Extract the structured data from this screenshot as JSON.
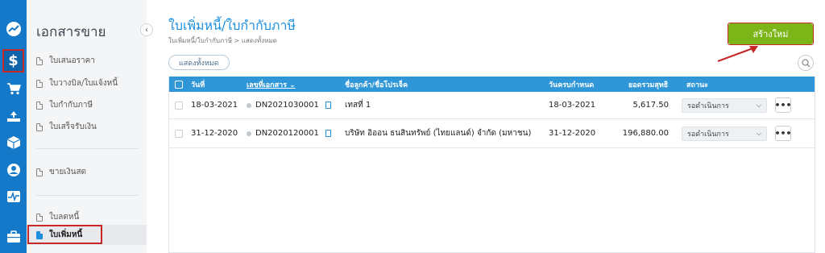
{
  "sidebar": {
    "title": "เอกสารขาย",
    "items": [
      {
        "label": "ใบเสนอราคา"
      },
      {
        "label": "ใบวางบิล/ใบแจ้งหนี้"
      },
      {
        "label": "ใบกำกับภาษี"
      },
      {
        "label": "ใบเสร็จรับเงิน"
      },
      {
        "label": "ขายเงินสด"
      },
      {
        "label": "ใบลดหนี้"
      },
      {
        "label": "ใบเพิ่มหนี้"
      }
    ],
    "collapse_icon": "‹"
  },
  "header": {
    "title": "ใบเพิ่มหนี้/ใบกำกับภาษี",
    "breadcrumb": "ใบเพิ่มหนี้/ใบกำกับภาษี > แสดงทั้งหมด",
    "create_label": "สร้างใหม่",
    "filter_label": "แสดงทั้งหมด"
  },
  "table": {
    "columns": {
      "date": "วันที่",
      "doc_no": "เลขที่เอกสาร ⌄",
      "customer": "ชื่อลูกค้า/ชื่อโปรเจ็ค",
      "due": "วันครบกำหนด",
      "total": "ยอดรวมสุทธิ",
      "status": "สถานะ"
    },
    "rows": [
      {
        "date": "18-03-2021",
        "doc_no": "DN2021030001",
        "customer": "เทสที่ 1",
        "due": "18-03-2021",
        "total": "5,617.50",
        "status": "รอดำเนินการ"
      },
      {
        "date": "31-12-2020",
        "doc_no": "DN2020120001",
        "customer": "บริษัท อิออน ธนสินทรัพย์ (ไทยแลนด์) จำกัด (มหาชน)",
        "due": "31-12-2020",
        "total": "196,880.00",
        "status": "รอดำเนินการ"
      }
    ],
    "more_label": "•••"
  },
  "colors": {
    "rail": "#1479c9",
    "accent": "#1c8fe0",
    "table_header": "#2f97d8",
    "create_button": "#7cb518",
    "highlight": "#c62828"
  }
}
